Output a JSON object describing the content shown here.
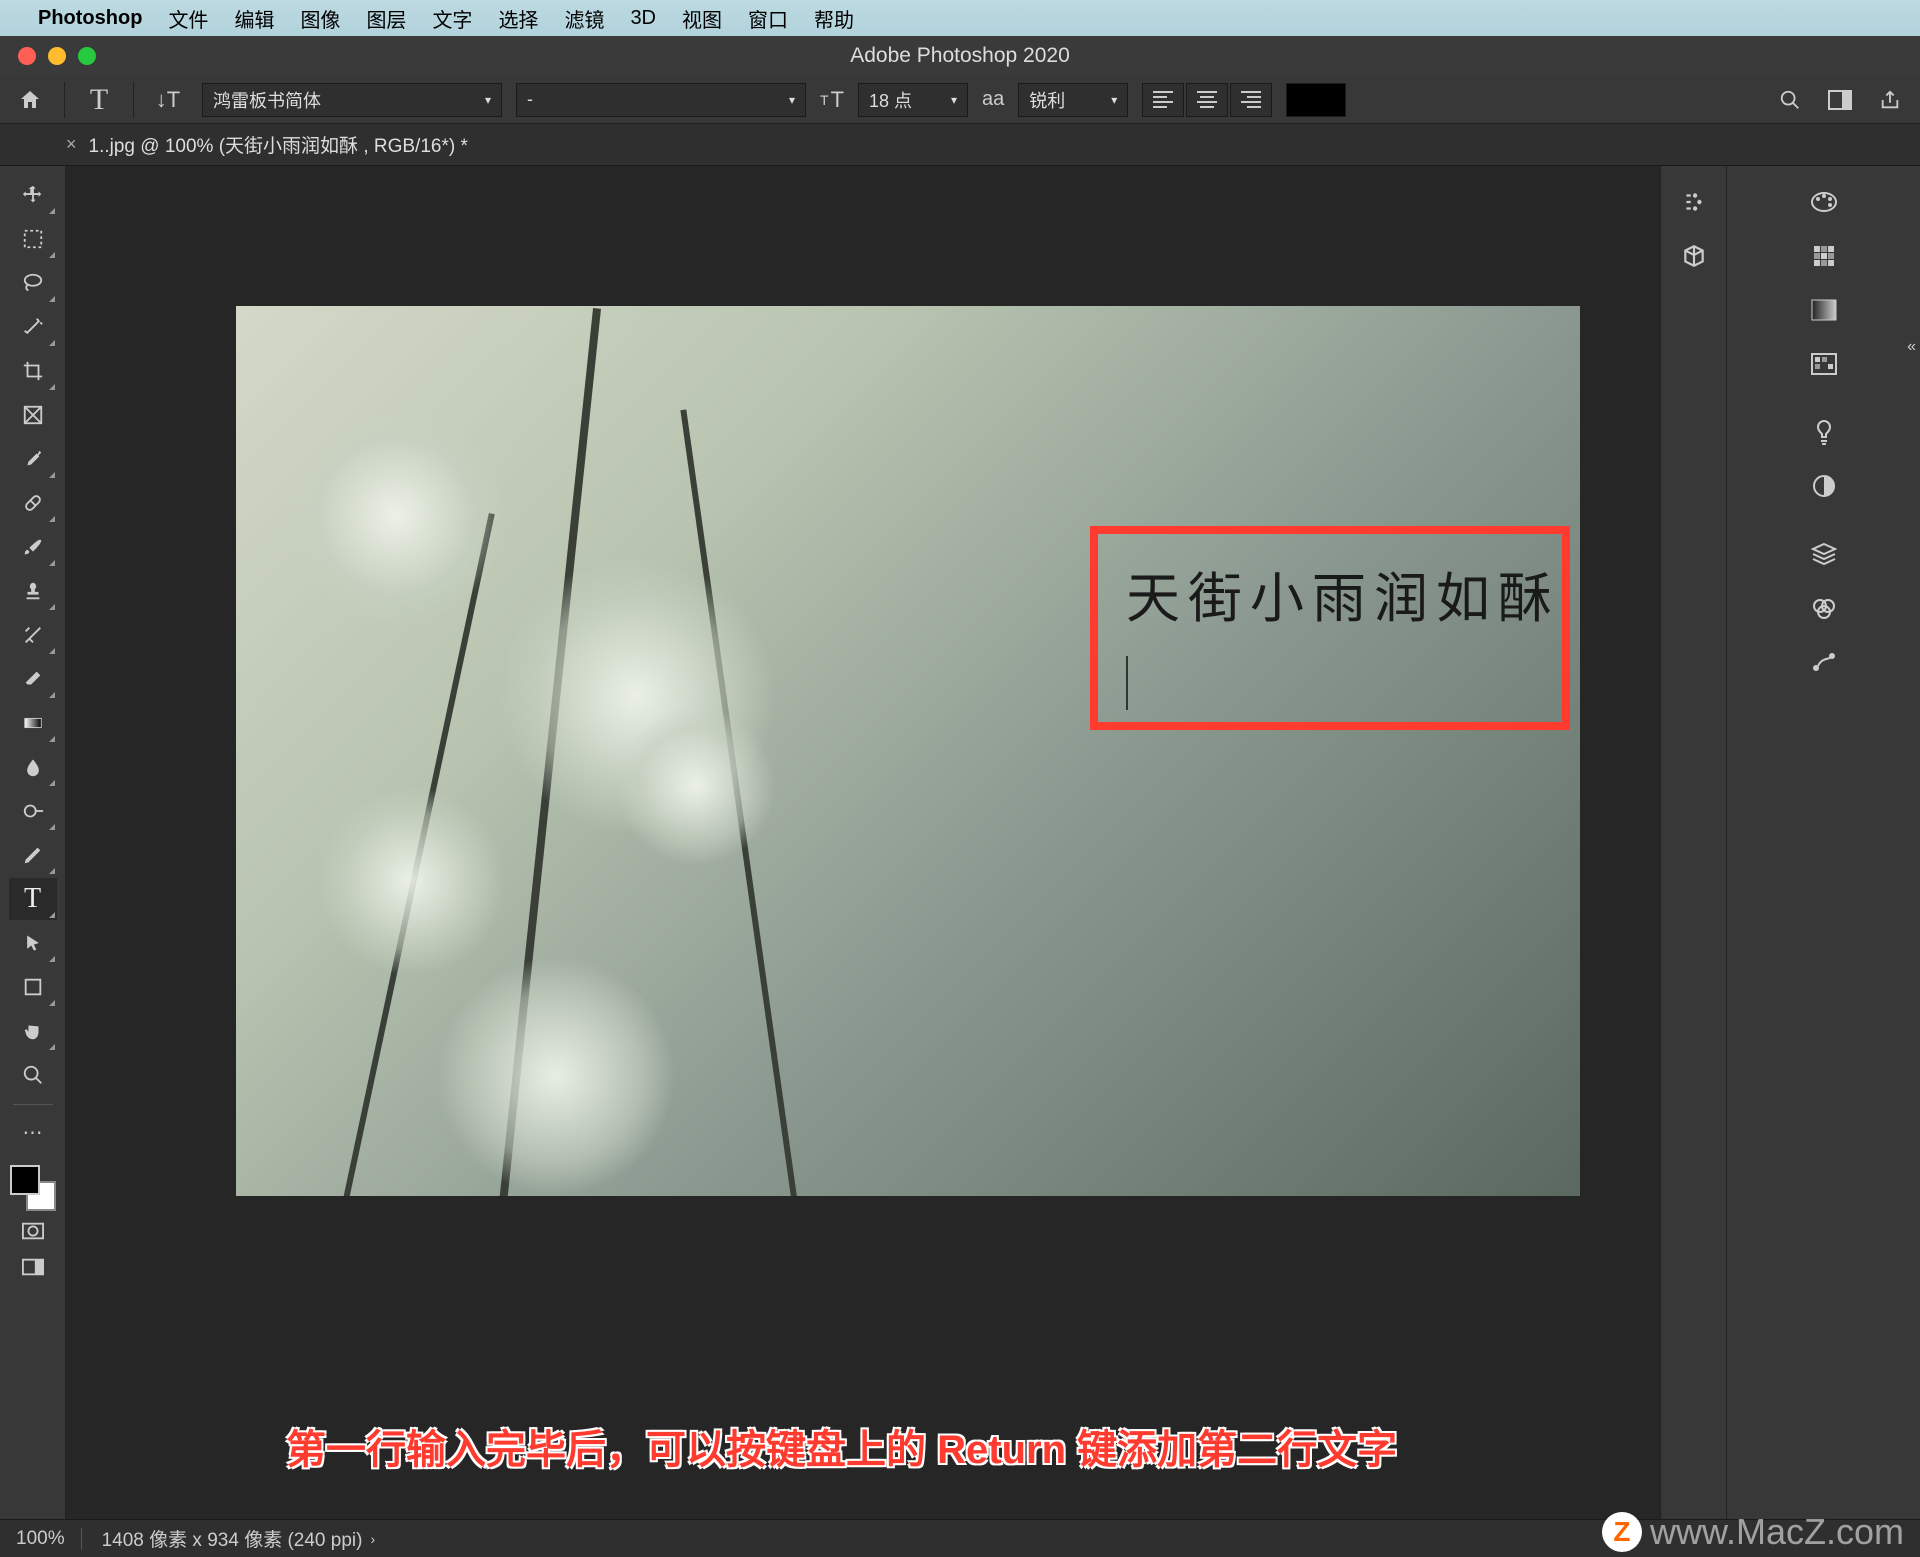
{
  "mac_menu": {
    "app_name": "Photoshop",
    "items": [
      "文件",
      "编辑",
      "图像",
      "图层",
      "文字",
      "选择",
      "滤镜",
      "3D",
      "视图",
      "窗口",
      "帮助"
    ]
  },
  "window": {
    "title": "Adobe Photoshop 2020"
  },
  "options_bar": {
    "font_family": "鸿雷板书简体",
    "font_style": "-",
    "font_size": "18 点",
    "aa_label": "锐利",
    "size_icon_label": "T",
    "aa_prefix": "aa"
  },
  "doc_tab": {
    "label": "1..jpg @ 100% (天街小雨润如酥 , RGB/16*) *"
  },
  "canvas": {
    "text_line1": "天街小雨润如酥"
  },
  "caption": "第一行输入完毕后，可以按键盘上的 Return 键添加第二行文字",
  "status": {
    "zoom": "100%",
    "dimensions": "1408 像素 x 934 像素 (240 ppi)"
  },
  "watermark": "www.MacZ.com",
  "tools": [
    "move",
    "marquee",
    "lasso",
    "wand",
    "crop",
    "frame",
    "eyedropper",
    "heal",
    "brush",
    "stamp",
    "history",
    "eraser",
    "gradient",
    "blur",
    "dodge",
    "pen",
    "type",
    "path",
    "shape",
    "hand",
    "zoom"
  ],
  "right_panel_icons_col1": [
    "properties",
    "3d"
  ],
  "right_panel_icons_col2": [
    "color",
    "swatches",
    "gradients",
    "patterns",
    "bulb",
    "adjust",
    "layers",
    "channels",
    "paths"
  ]
}
